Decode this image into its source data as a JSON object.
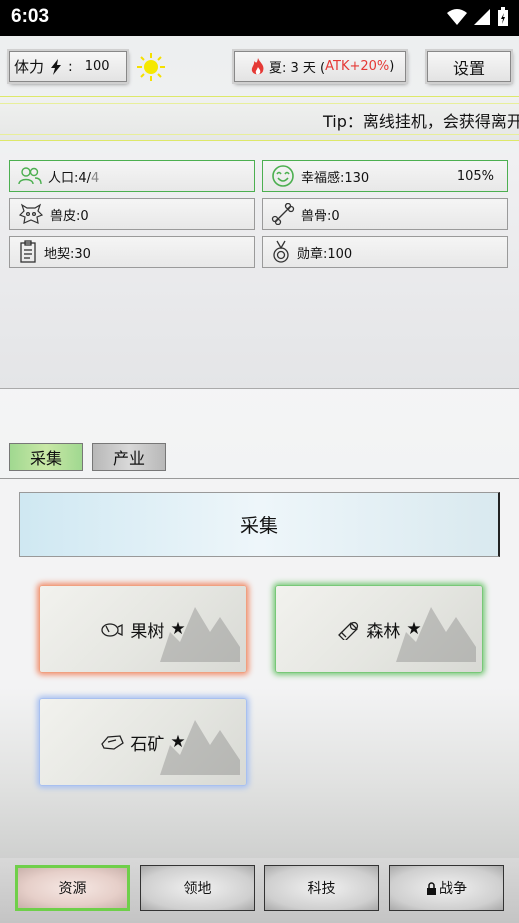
{
  "status_bar": {
    "time": "6:03"
  },
  "top_bar": {
    "stamina_label": "体力",
    "stamina_value": "100",
    "season": "夏: 3 天 (",
    "atk_bonus": "ATK+20%",
    "season_close": ")",
    "settings_label": "设置"
  },
  "tip": {
    "text": "Tip：离线挂机，会获得离开"
  },
  "resources": [
    {
      "label": "人口:4/",
      "extra": "4"
    },
    {
      "label": "幸福感:130",
      "percent": "105%"
    },
    {
      "label": "兽皮:0"
    },
    {
      "label": "兽骨:0"
    },
    {
      "label": "地契:30"
    },
    {
      "label": "勋章:100"
    }
  ],
  "sub_tabs": [
    {
      "label": "采集"
    },
    {
      "label": "产业"
    }
  ],
  "section": {
    "title": "采集"
  },
  "cards": [
    {
      "label": "果树",
      "star": "★",
      "glow": "#f09070",
      "icon": "fruit-icon"
    },
    {
      "label": "森林",
      "star": "★",
      "glow": "#78c878",
      "icon": "log-icon"
    },
    {
      "label": "石矿",
      "star": "★",
      "glow": "#a8c0f0",
      "icon": "ore-icon"
    }
  ],
  "bottom_nav": [
    {
      "label": "资源"
    },
    {
      "label": "领地"
    },
    {
      "label": "科技"
    },
    {
      "label": "战争"
    }
  ],
  "colors": {
    "accent_green": "#4caf50",
    "red": "#e53935",
    "sun": "#f5e000"
  }
}
